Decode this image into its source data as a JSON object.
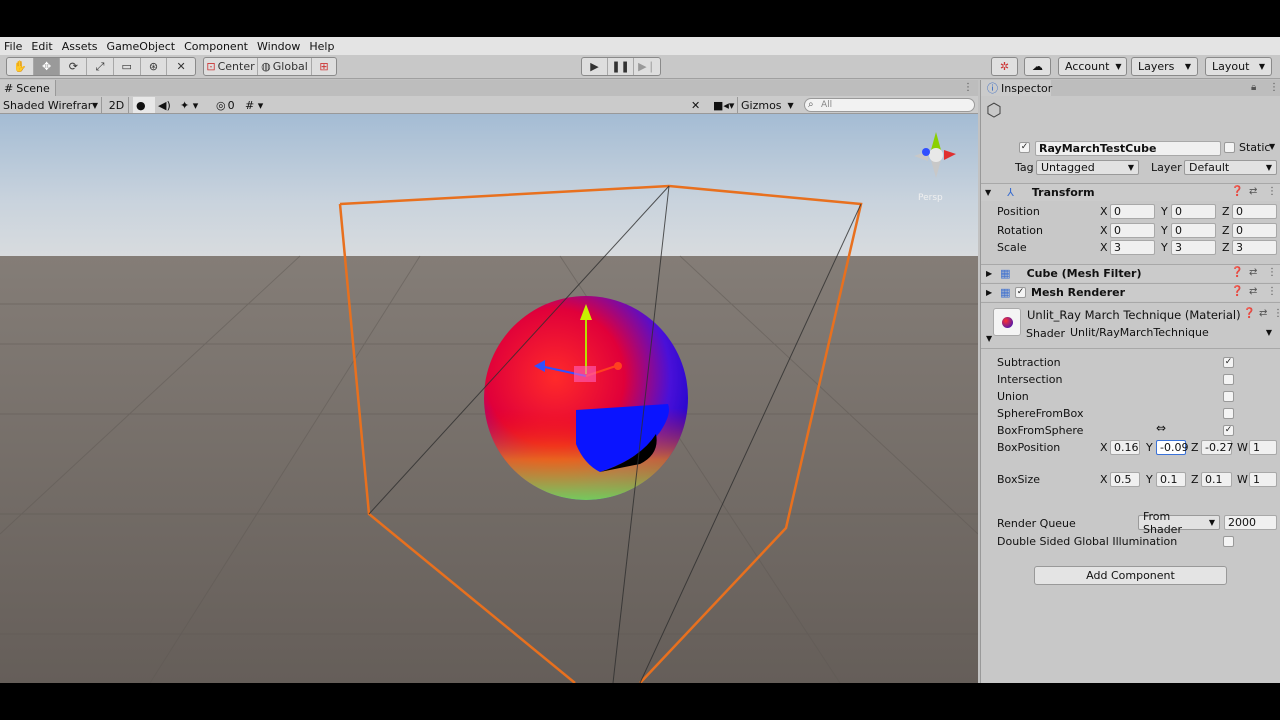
{
  "menu": [
    "File",
    "Edit",
    "Assets",
    "GameObject",
    "Component",
    "Window",
    "Help"
  ],
  "toolbar": {
    "pivot_label": "Center",
    "space_label": "Global",
    "account_label": "Account",
    "layers_label": "Layers",
    "layout_label": "Layout"
  },
  "scene": {
    "tab_label": "Scene",
    "draw_mode": "Shaded Wireframe",
    "mode_2d": "2D",
    "hidden_count": "0",
    "gizmos_label": "Gizmos",
    "search_placeholder": "All",
    "persp_label": "Persp"
  },
  "inspector": {
    "tab_label": "Inspector",
    "object_name": "RayMarchTestCube",
    "active_checked": true,
    "static_label": "Static",
    "tag_label": "Tag",
    "tag_value": "Untagged",
    "layer_label": "Layer",
    "layer_value": "Default",
    "transform": {
      "title": "Transform",
      "position_label": "Position",
      "rotation_label": "Rotation",
      "scale_label": "Scale",
      "position": {
        "x": "0",
        "y": "0",
        "z": "0"
      },
      "rotation": {
        "x": "0",
        "y": "0",
        "z": "0"
      },
      "scale": {
        "x": "3",
        "y": "3",
        "z": "3"
      }
    },
    "mesh_filter_title": "Cube (Mesh Filter)",
    "mesh_renderer_title": "Mesh Renderer",
    "material": {
      "title": "Unlit_Ray March Technique (Material)",
      "shader_label": "Shader",
      "shader_value": "Unlit/RayMarchTechnique"
    },
    "props": {
      "subtraction_label": "Subtraction",
      "intersection_label": "Intersection",
      "union_label": "Union",
      "sphere_from_box_label": "SphereFromBox",
      "box_from_sphere_label": "BoxFromSphere",
      "box_position_label": "BoxPosition",
      "box_position": {
        "x": "0.16",
        "y": "-0.09",
        "z": "-0.27",
        "w": "1"
      },
      "box_size_label": "BoxSize",
      "box_size": {
        "x": "0.5",
        "y": "0.1",
        "z": "0.1",
        "w": "1"
      },
      "render_queue_label": "Render Queue",
      "render_queue_mode": "From Shader",
      "render_queue_value": "2000",
      "dsgi_label": "Double Sided Global Illumination"
    },
    "checks": {
      "subtraction": true,
      "intersection": false,
      "union": false,
      "sphere_from_box": false,
      "box_from_sphere": true,
      "dsgi": false
    },
    "add_component_label": "Add Component"
  },
  "axes": {
    "x": "X",
    "y": "Y",
    "z": "Z",
    "w": "W"
  },
  "colors": {
    "selection_outline": "#e8701e",
    "sky_top": "#9fb8d0",
    "ground": "#6d6661",
    "app_bg": "#c2c2c2"
  }
}
